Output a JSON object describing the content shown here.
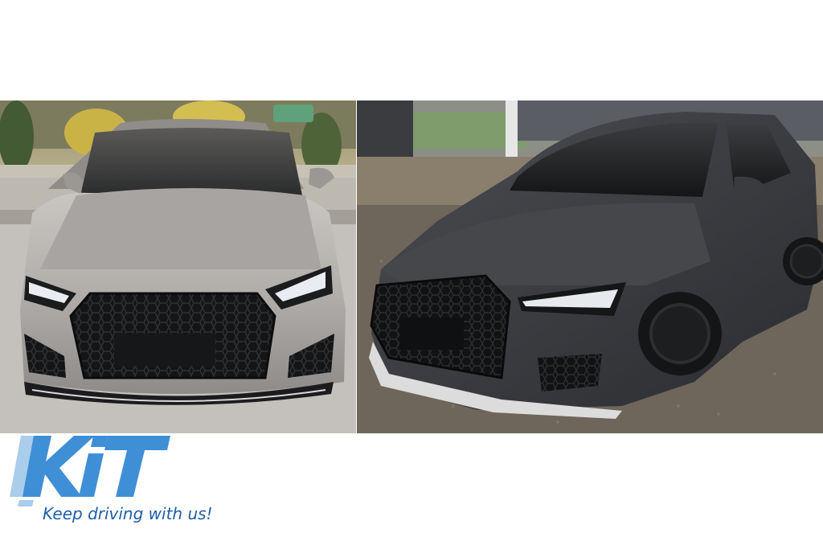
{
  "brand": {
    "logo_text": "KiT",
    "tagline": "Keep driving with us!",
    "color": "#1f5fa8",
    "logo_colors": [
      "#3f8fd6",
      "#a9cdeb"
    ]
  },
  "photos": [
    {
      "subject": "silver car front view, black honeycomb grille, parked on pavement",
      "body_color": "#b8b4b0",
      "grille_color": "#151618"
    },
    {
      "subject": "dark grey hatchback three-quarter front view, black honeycomb grille, parked on gravel",
      "body_color": "#3b3c40",
      "grille_color": "#121314"
    }
  ]
}
